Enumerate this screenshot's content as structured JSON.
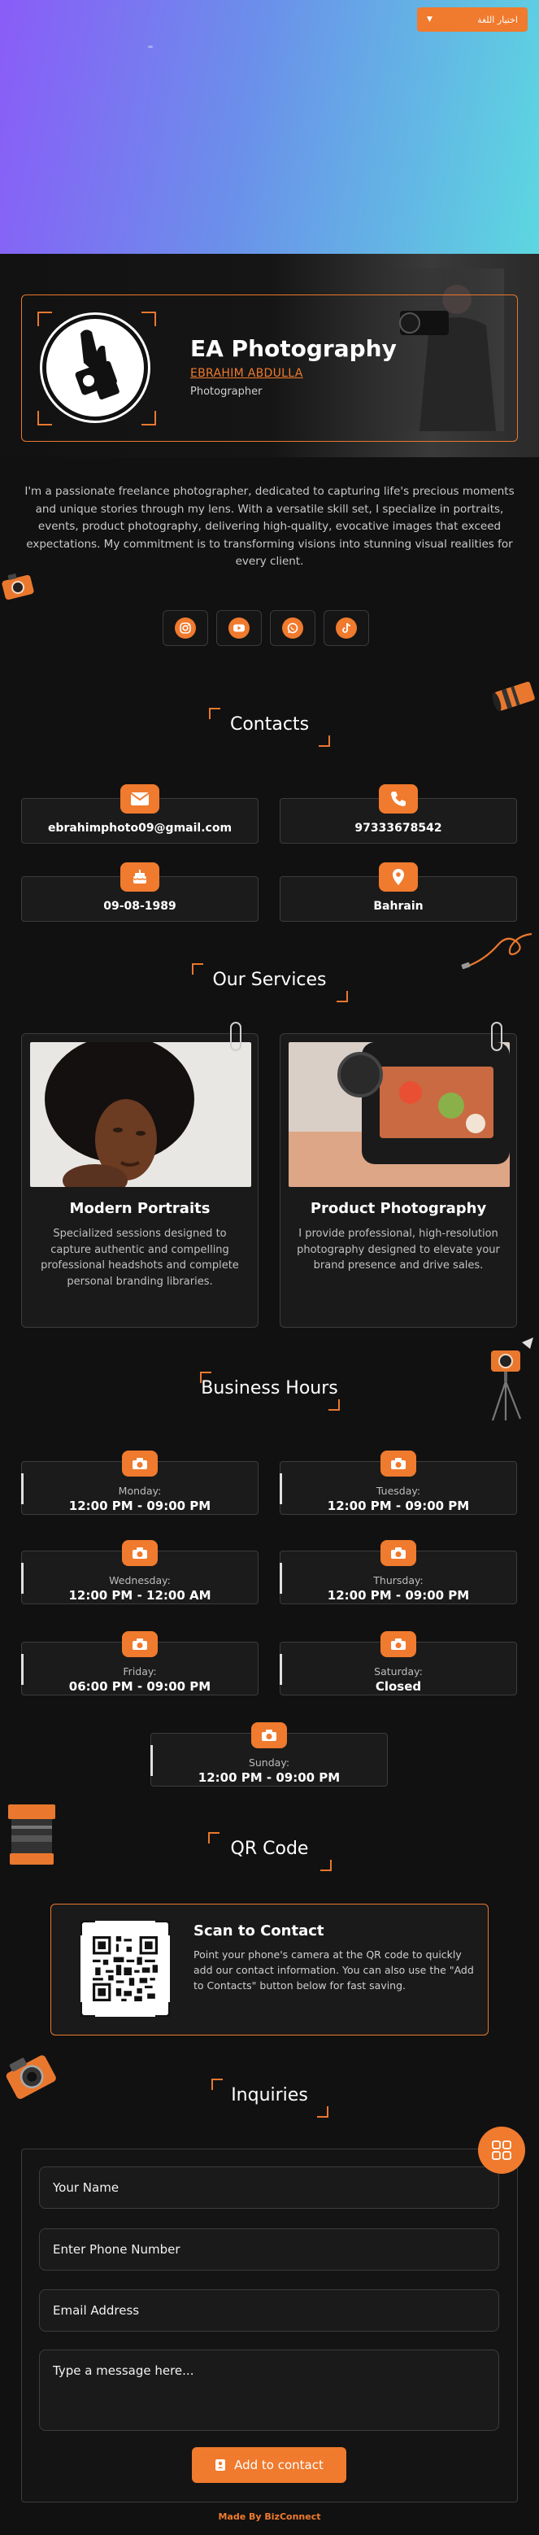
{
  "language_button": {
    "label": "اختيار اللغة",
    "icon": "chevron-down-icon"
  },
  "profile": {
    "business_name": "EA Photography",
    "owner_name": "EBRAHIM ABDULLA",
    "role": "Photographer",
    "about": "I'm a passionate freelance photographer, dedicated to capturing life's precious moments and unique stories through my lens. With a versatile skill set, I specialize in portraits, events, product photography, delivering high-quality, evocative images that exceed expectations. My commitment is to transforming visions into stunning visual realities for every client."
  },
  "social": [
    {
      "name": "instagram-icon"
    },
    {
      "name": "youtube-icon"
    },
    {
      "name": "whatsapp-icon"
    },
    {
      "name": "tiktok-icon"
    }
  ],
  "contacts": {
    "title": "Contacts",
    "items": [
      {
        "icon": "email-icon",
        "value": "ebrahimphoto09@gmail.com"
      },
      {
        "icon": "phone-icon",
        "value": "97333678542"
      },
      {
        "icon": "cake-icon",
        "value": "09-08-1989"
      },
      {
        "icon": "location-icon",
        "value": "Bahrain"
      }
    ]
  },
  "services": {
    "title": "Our Services",
    "items": [
      {
        "title": "Modern Portraits",
        "description": "Specialized sessions designed to capture authentic and compelling professional headshots and complete personal branding libraries."
      },
      {
        "title": "Product Photography",
        "description": "I provide professional, high-resolution photography designed to elevate your brand presence and drive sales."
      }
    ]
  },
  "hours": {
    "title": "Business Hours",
    "days": [
      {
        "day": "Monday:",
        "time": "12:00 PM - 09:00 PM"
      },
      {
        "day": "Tuesday:",
        "time": "12:00 PM - 09:00 PM"
      },
      {
        "day": "Wednesday:",
        "time": "12:00 PM - 12:00 AM"
      },
      {
        "day": "Thursday:",
        "time": "12:00 PM - 09:00 PM"
      },
      {
        "day": "Friday:",
        "time": "06:00 PM - 09:00 PM"
      },
      {
        "day": "Saturday:",
        "time": "Closed"
      },
      {
        "day": "Sunday:",
        "time": "12:00 PM - 09:00 PM"
      }
    ]
  },
  "qr": {
    "title": "QR Code",
    "card_title": "Scan to Contact",
    "description": "Point your phone's camera at the QR code to quickly add our contact information. You can also use the \"Add to Contacts\" button below for fast saving."
  },
  "inquiries": {
    "title": "Inquiries",
    "name_placeholder": "Your Name",
    "phone_placeholder": "Enter Phone Number",
    "email_placeholder": "Email Address",
    "message_placeholder": "Type a message here...",
    "submit_label": "Add to contact"
  },
  "footer": {
    "text": "Made By BizConnect"
  },
  "colors": {
    "accent": "#f07a2d",
    "background": "#111111",
    "card": "#1b1b1b"
  }
}
